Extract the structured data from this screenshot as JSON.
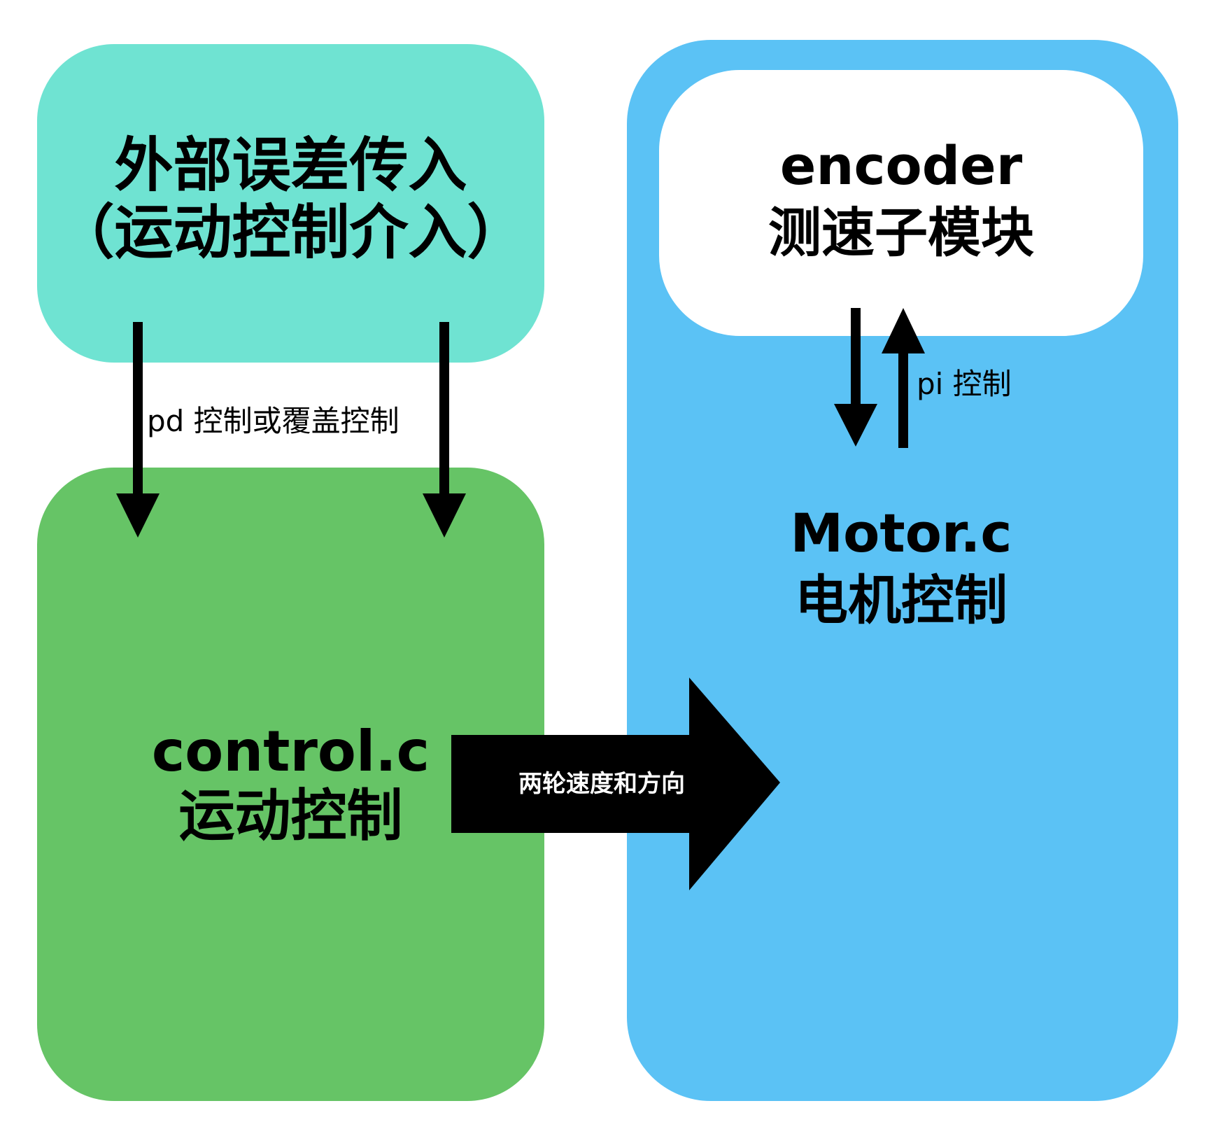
{
  "external_box": {
    "line1": "外部误差传入",
    "line2": "（运动控制介入）"
  },
  "control_box": {
    "line1": "control.c",
    "line2": "运动控制"
  },
  "motor_box": {
    "line1": "Motor.c",
    "line2": "电机控制"
  },
  "encoder_box": {
    "line1": "encoder",
    "line2": "测速子模块"
  },
  "edges": {
    "pd_label": "pd 控制或覆盖控制",
    "pi_label": "pi 控制",
    "speed_label": "两轮速度和方向"
  },
  "colors": {
    "external": "#6fe3d2",
    "control": "#66c466",
    "motor": "#5bc2f5",
    "encoder": "#ffffff",
    "arrow": "#000000"
  }
}
